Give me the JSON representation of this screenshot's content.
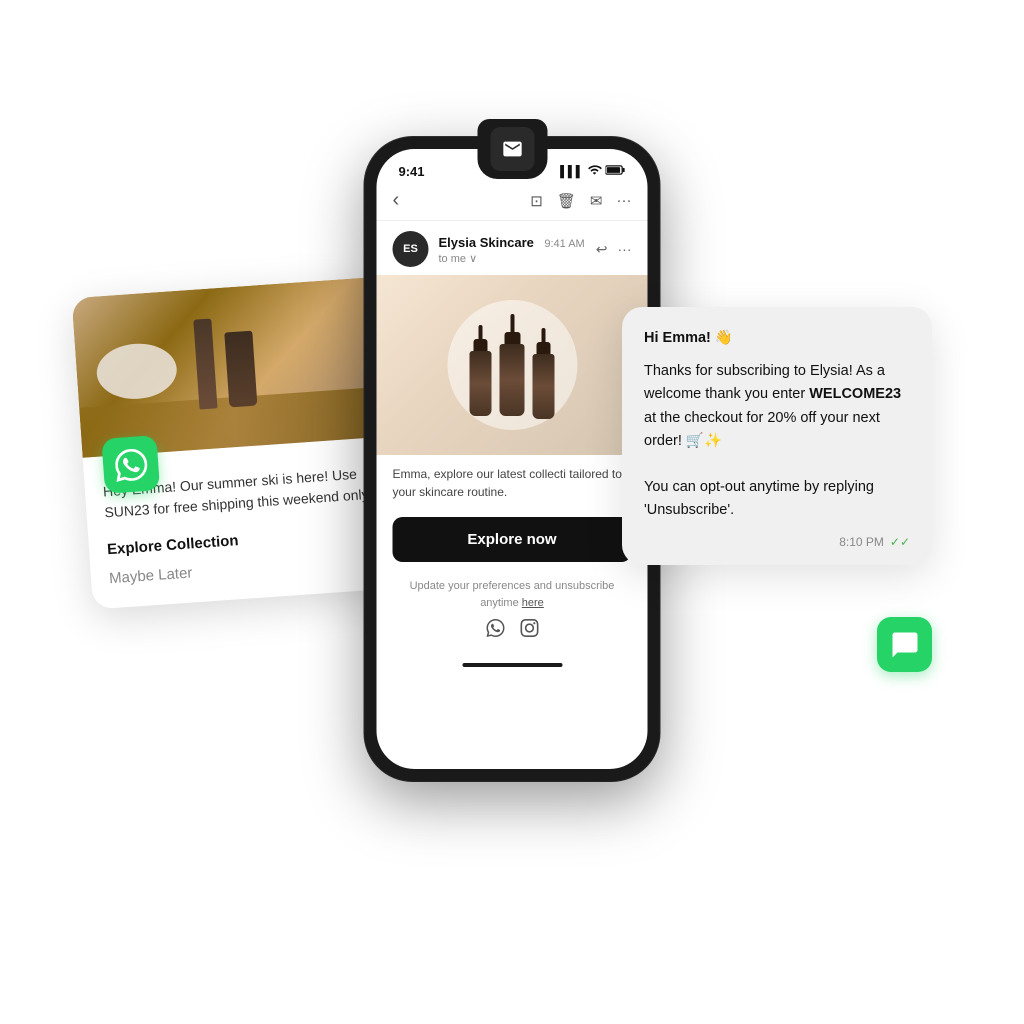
{
  "scene": {
    "background": "#ffffff"
  },
  "whatsapp_card": {
    "message": "Hey Emma! Our summer ski is here! Use SUN23 for free shipping this weekend only",
    "explore_btn": "Explore Collection",
    "maybe_later": "Maybe Later"
  },
  "phone": {
    "status_time": "9:41",
    "signal": "▌▌▌",
    "wifi": "WiFi",
    "battery": "🔋",
    "email_from": "Elysia Skincare",
    "email_time": "9:41 AM",
    "email_to": "to me ∨",
    "sender_initials": "ES",
    "body_text": "Emma, explore our latest collecti tailored to your skincare routine.",
    "explore_btn": "Explore now",
    "footer_text": "Update your preferences and unsubscribe anytime",
    "footer_link": "here",
    "mail_notification_icon": "✉"
  },
  "sms_bubble": {
    "greeting": "Hi Emma! 👋",
    "message": "Thanks for subscribing to Elysia! As a welcome thank you enter WELCOME23 at the checkout for 20% off your next order! 🛒✨\n\nYou can opt-out anytime by replying 'Unsubscribe'.",
    "time": "8:10 PM",
    "check_icon": "✓✓"
  }
}
